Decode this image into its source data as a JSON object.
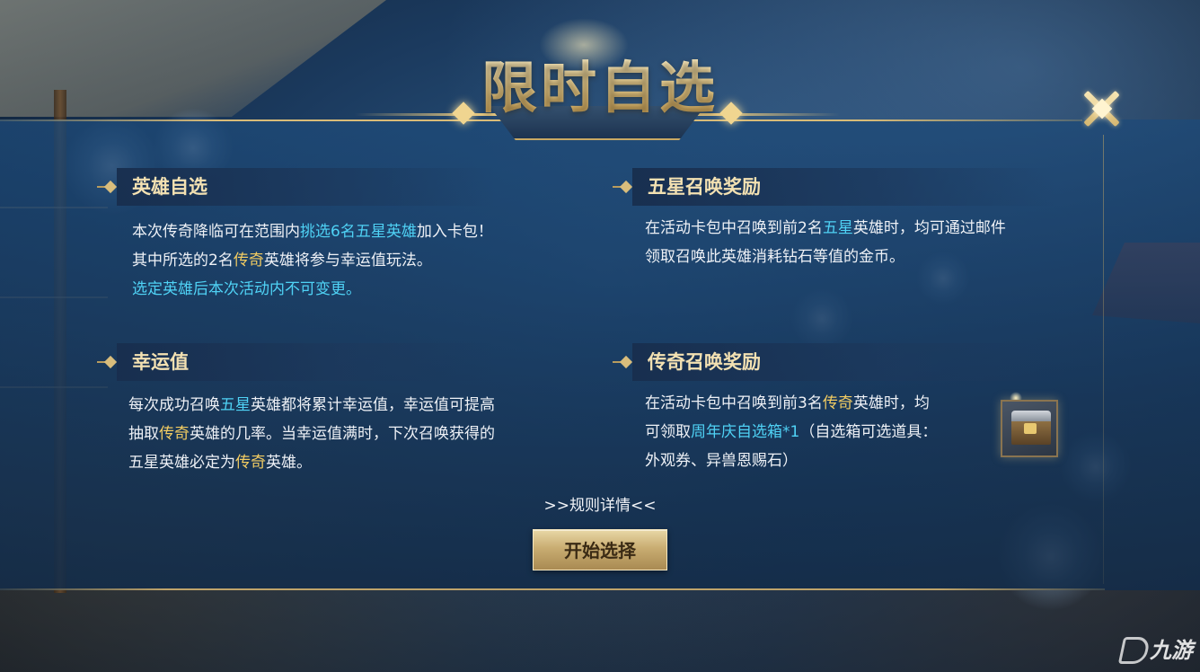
{
  "title": "限时自选",
  "close_icon": "close-x-icon",
  "sections": {
    "hero_select": {
      "title": "英雄自选",
      "lines": [
        [
          {
            "t": "本次传奇降临可在范围内"
          },
          {
            "t": "挑选6名五星英雄",
            "c": "cyan"
          },
          {
            "t": "加入卡包！"
          }
        ],
        [
          {
            "t": "其中所选的2名"
          },
          {
            "t": "传奇",
            "c": "gold"
          },
          {
            "t": "英雄将参与幸运值玩法。"
          }
        ],
        [
          {
            "t": "选定英雄后本次活动内不可变更。",
            "c": "cyan"
          }
        ]
      ]
    },
    "five_star_reward": {
      "title": "五星召唤奖励",
      "lines": [
        [
          {
            "t": "在活动卡包中召唤到前2名"
          },
          {
            "t": "五星",
            "c": "cyan"
          },
          {
            "t": "英雄时，均可通过邮件"
          }
        ],
        [
          {
            "t": "领取召唤此英雄消耗钻石等值的金币。"
          }
        ]
      ]
    },
    "luck_value": {
      "title": "幸运值",
      "lines": [
        [
          {
            "t": "每次成功召唤"
          },
          {
            "t": "五星",
            "c": "cyan"
          },
          {
            "t": "英雄都将累计幸运值，幸运值可提高"
          }
        ],
        [
          {
            "t": "抽取"
          },
          {
            "t": "传奇",
            "c": "gold"
          },
          {
            "t": "英雄的几率。当幸运值满时，下次召唤获得的"
          }
        ],
        [
          {
            "t": "五星英雄必定为"
          },
          {
            "t": "传奇",
            "c": "gold"
          },
          {
            "t": "英雄。"
          }
        ]
      ]
    },
    "legend_reward": {
      "title": "传奇召唤奖励",
      "lines": [
        [
          {
            "t": "在活动卡包中召唤到前3名"
          },
          {
            "t": "传奇",
            "c": "gold"
          },
          {
            "t": "英雄时，均"
          }
        ],
        [
          {
            "t": "可领取"
          },
          {
            "t": "周年庆自选箱*1",
            "c": "cyan"
          },
          {
            "t": "（自选箱可选道具："
          }
        ],
        [
          {
            "t": "外观券、异兽恩赐石）"
          }
        ]
      ],
      "reward_icon": "treasure-chest-icon"
    }
  },
  "rules_link": ">>规则详情<<",
  "start_button": "开始选择",
  "watermark": {
    "icon": "jiuyou-logo-icon",
    "text": "九游"
  },
  "colors": {
    "cyan": "#4fd2f5",
    "gold": "#f2cc62",
    "title_gold": "#f5e2b0",
    "panel": "#1e4a78"
  }
}
